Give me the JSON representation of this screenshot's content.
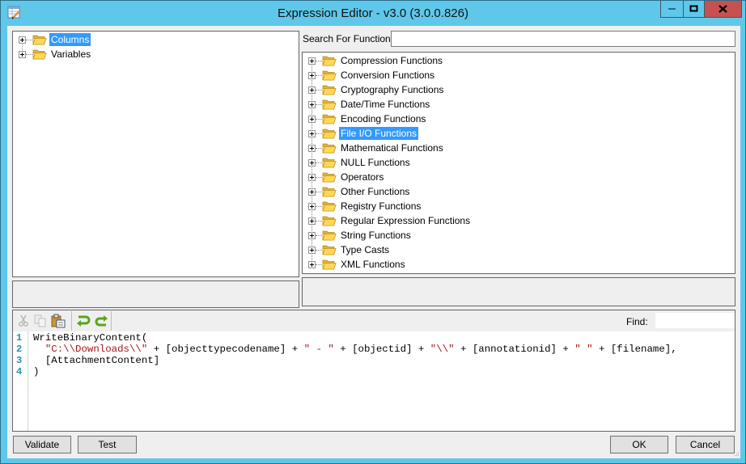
{
  "window": {
    "title": "Expression Editor - v3.0 (3.0.0.826)",
    "controls": [
      "minimize",
      "maximize",
      "close"
    ]
  },
  "left_tree": {
    "items": [
      {
        "label": "Columns",
        "selected": true,
        "icon": "folder-icon"
      },
      {
        "label": "Variables",
        "selected": false,
        "icon": "folder-icon"
      }
    ]
  },
  "search": {
    "label": "Search For Function:",
    "value": "",
    "placeholder": ""
  },
  "function_tree": {
    "items": [
      {
        "label": "Compression Functions"
      },
      {
        "label": "Conversion Functions"
      },
      {
        "label": "Cryptography Functions"
      },
      {
        "label": "Date/Time Functions"
      },
      {
        "label": "Encoding Functions"
      },
      {
        "label": "File I/O Functions",
        "selected": true
      },
      {
        "label": "Mathematical Functions"
      },
      {
        "label": "NULL Functions"
      },
      {
        "label": "Operators"
      },
      {
        "label": "Other Functions"
      },
      {
        "label": "Registry Functions"
      },
      {
        "label": "Regular Expression Functions"
      },
      {
        "label": "String Functions"
      },
      {
        "label": "Type Casts"
      },
      {
        "label": "XML Functions"
      }
    ]
  },
  "editor": {
    "toolbar": {
      "cut": "cut-icon",
      "copy": "copy-icon",
      "paste": "paste-icon",
      "undo": "undo-icon",
      "redo": "redo-icon",
      "find_label": "Find:",
      "find_value": ""
    },
    "line_numbers": [
      "1",
      "2",
      "3",
      "4"
    ],
    "lines": [
      [
        {
          "t": "WriteBinaryContent(",
          "s": false
        }
      ],
      [
        {
          "t": "  ",
          "s": false
        },
        {
          "t": "\"C:\\\\Downloads\\\\\"",
          "s": true
        },
        {
          "t": " + [objecttypecodename] + ",
          "s": false
        },
        {
          "t": "\" - \"",
          "s": true
        },
        {
          "t": " + [objectid] + ",
          "s": false
        },
        {
          "t": "\"\\\\\"",
          "s": true
        },
        {
          "t": " + [annotationid] + ",
          "s": false
        },
        {
          "t": "\" \"",
          "s": true
        },
        {
          "t": " + [filename],",
          "s": false
        }
      ],
      [
        {
          "t": "  [AttachmentContent]",
          "s": false
        }
      ],
      [
        {
          "t": ")",
          "s": false
        }
      ]
    ]
  },
  "buttons": {
    "validate": "Validate",
    "test": "Test",
    "ok": "OK",
    "cancel": "Cancel"
  },
  "colors": {
    "titlebar": "#5fc8ea",
    "close": "#c75050",
    "selection": "#3399ff",
    "string": "#a31515",
    "line_number": "#2b91af"
  }
}
